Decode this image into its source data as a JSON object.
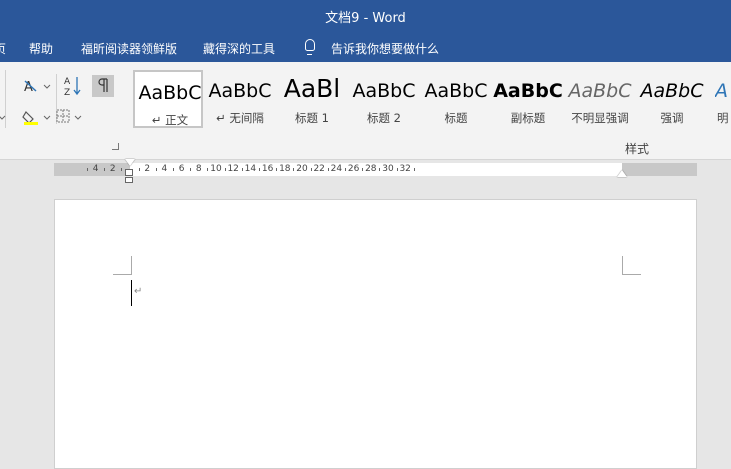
{
  "window": {
    "title": "文档9  -  Word"
  },
  "menu": {
    "items": [
      {
        "key": "cut",
        "label": "页"
      },
      {
        "key": "help",
        "label": "帮助"
      },
      {
        "key": "foxit",
        "label": "福昕阅读器领鲜版"
      },
      {
        "key": "cangde",
        "label": "藏得深的工具"
      },
      {
        "key": "tellme",
        "label": "告诉我你想要做什么"
      }
    ]
  },
  "ribbon": {
    "styles_group_label": "样式",
    "styles": [
      {
        "preview": "AaBbC",
        "name": "↵ 正文",
        "selected": true
      },
      {
        "preview": "AaBbC",
        "name": "↵ 无间隔"
      },
      {
        "preview": "AaBl",
        "name": "标题 1"
      },
      {
        "preview": "AaBbC",
        "name": "标题 2"
      },
      {
        "preview": "AaBbC",
        "name": "标题"
      },
      {
        "preview": "AaBbC",
        "name": "副标题"
      },
      {
        "preview": "AaBbC",
        "name": "不明显强调"
      },
      {
        "preview": "AaBbC",
        "name": "强调"
      },
      {
        "preview": "A",
        "name": "明"
      }
    ]
  },
  "ruler": {
    "labels": [
      "4",
      "2",
      "2",
      "4",
      "6",
      "8",
      "10",
      "12",
      "14",
      "16",
      "18",
      "20",
      "22",
      "24",
      "26",
      "28",
      "30",
      "32"
    ]
  },
  "document": {
    "paragraph_mark": "↵"
  },
  "colors": {
    "brand": "#2b579a",
    "accent_blue": "#2e75b6"
  }
}
